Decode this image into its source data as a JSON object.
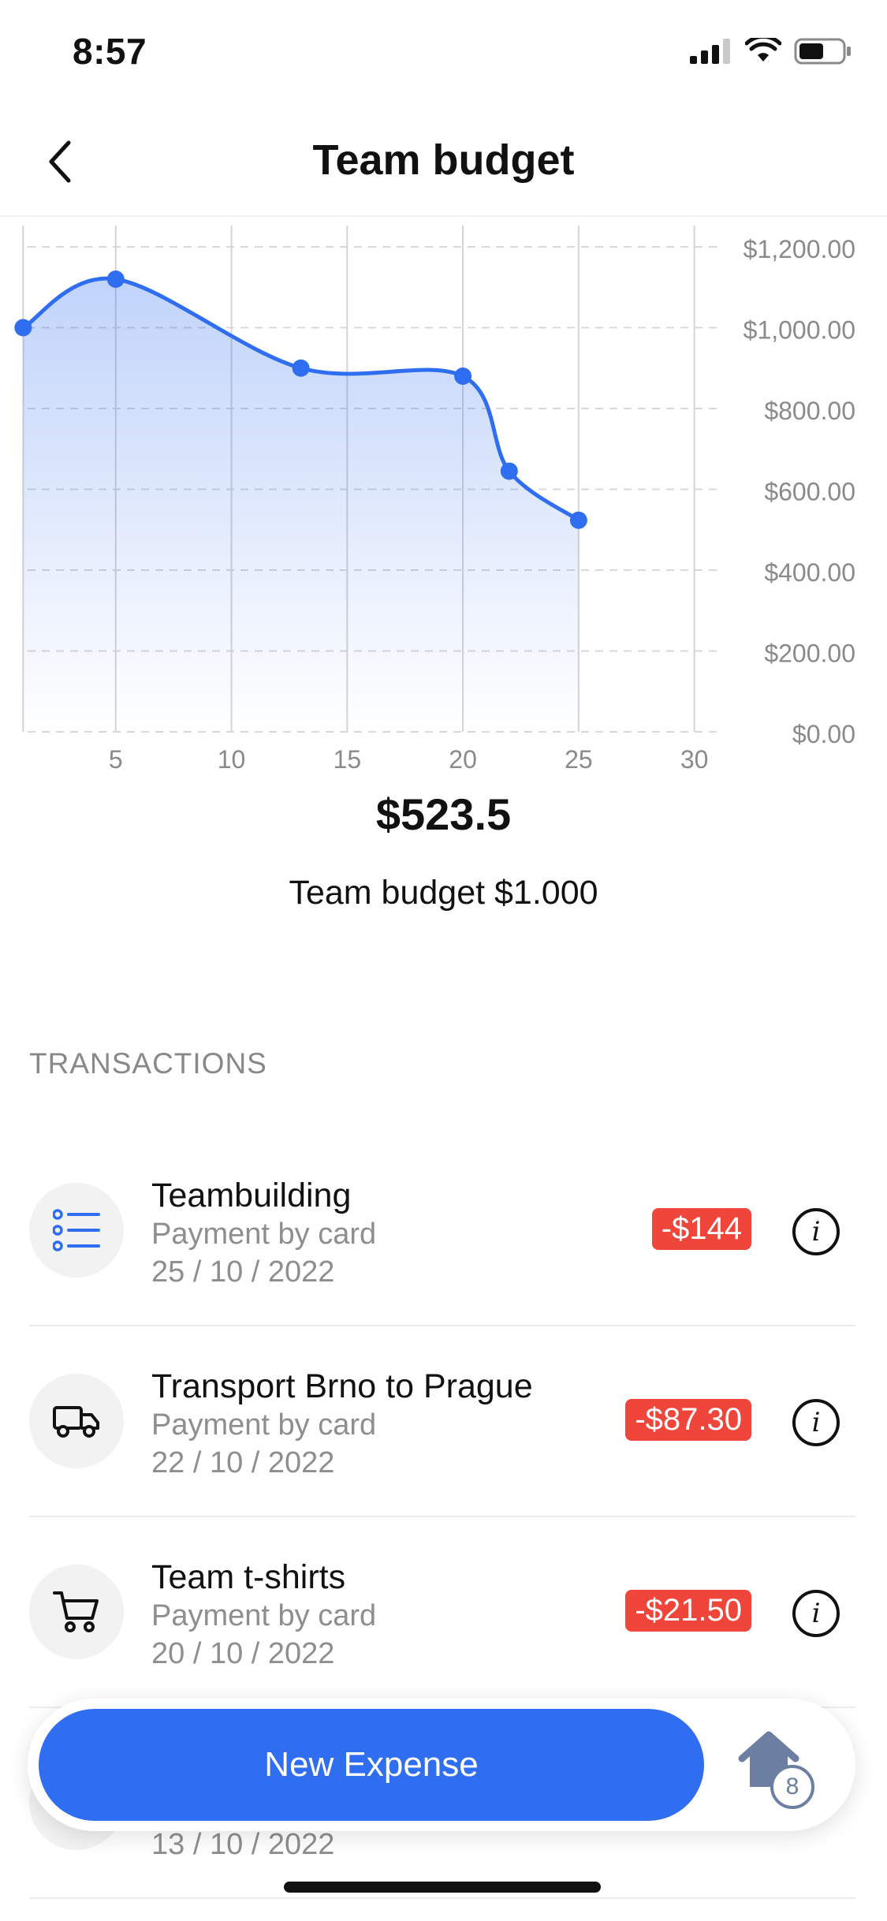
{
  "status_bar": {
    "time": "8:57"
  },
  "nav": {
    "title": "Team budget"
  },
  "chart_data": {
    "type": "area",
    "x": [
      1,
      5,
      13,
      20,
      22,
      25
    ],
    "values": [
      1000,
      1120,
      900,
      880,
      645,
      523.5
    ],
    "xlim": [
      0,
      31
    ],
    "ylim": [
      0,
      1200
    ],
    "x_ticks": [
      5,
      10,
      15,
      20,
      25,
      30
    ],
    "y_ticks": [
      "$0.00",
      "$200.00",
      "$400.00",
      "$600.00",
      "$800.00",
      "$1,000.00",
      "$1,200.00"
    ],
    "y_tick_values": [
      0,
      200,
      400,
      600,
      800,
      1000,
      1200
    ],
    "grid": true,
    "color": "#2f6ef0"
  },
  "summary": {
    "balance": "$523.5",
    "budget_caption": "Team budget $1.000"
  },
  "transactions": {
    "section_title": "TRANSACTIONS",
    "items": [
      {
        "title": "Teambuilding",
        "method": "Payment by card",
        "date": "25 / 10 / 2022",
        "amount": "-$144",
        "icon": "list-icon"
      },
      {
        "title": "Transport Brno to Prague",
        "method": "Payment by card",
        "date": "22 / 10 / 2022",
        "amount": "-$87.30",
        "icon": "truck-icon"
      },
      {
        "title": "Team t-shirts",
        "method": "Payment by card",
        "date": "20 / 10 / 2022",
        "amount": "-$21.50",
        "icon": "cart-icon"
      },
      {
        "title": "",
        "method": "",
        "date": "13 / 10 / 2022",
        "amount": "",
        "icon": ""
      }
    ]
  },
  "dock": {
    "new_expense_label": "New Expense",
    "home_badge": "8"
  },
  "colors": {
    "accent": "#2f6ef0",
    "negative": "#f0453a"
  }
}
